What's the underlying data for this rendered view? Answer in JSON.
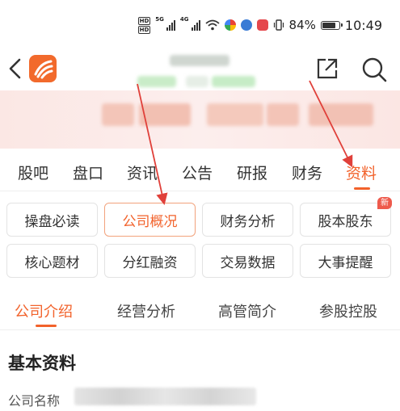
{
  "status_bar": {
    "network_hd": "HD",
    "net1": "5G",
    "net2": "4G",
    "battery_pct": "84%",
    "battery_level": 0.84,
    "time": "10:49"
  },
  "header": {
    "icons": [
      "back-arrow-icon",
      "app-logo-icon",
      "share-icon",
      "search-icon"
    ],
    "brand_color": "#f26a2c"
  },
  "main_tabs": {
    "items": [
      "股吧",
      "盘口",
      "资讯",
      "公告",
      "研报",
      "财务",
      "资料"
    ],
    "active_index": 6
  },
  "grid": {
    "items": [
      {
        "label": "操盘必读"
      },
      {
        "label": "公司概况",
        "active": true
      },
      {
        "label": "财务分析"
      },
      {
        "label": "股本股东",
        "badge": "新"
      },
      {
        "label": "核心题材"
      },
      {
        "label": "分红融资"
      },
      {
        "label": "交易数据"
      },
      {
        "label": "大事提醒"
      }
    ]
  },
  "sub_tabs": {
    "items": [
      "公司介绍",
      "经营分析",
      "高管简介",
      "参股控股"
    ],
    "active_index": 0
  },
  "section": {
    "title": "基本资料",
    "company_name_label": "公司名称"
  },
  "colors": {
    "accent": "#f2622b",
    "annotation_arrow": "#e0403a"
  }
}
